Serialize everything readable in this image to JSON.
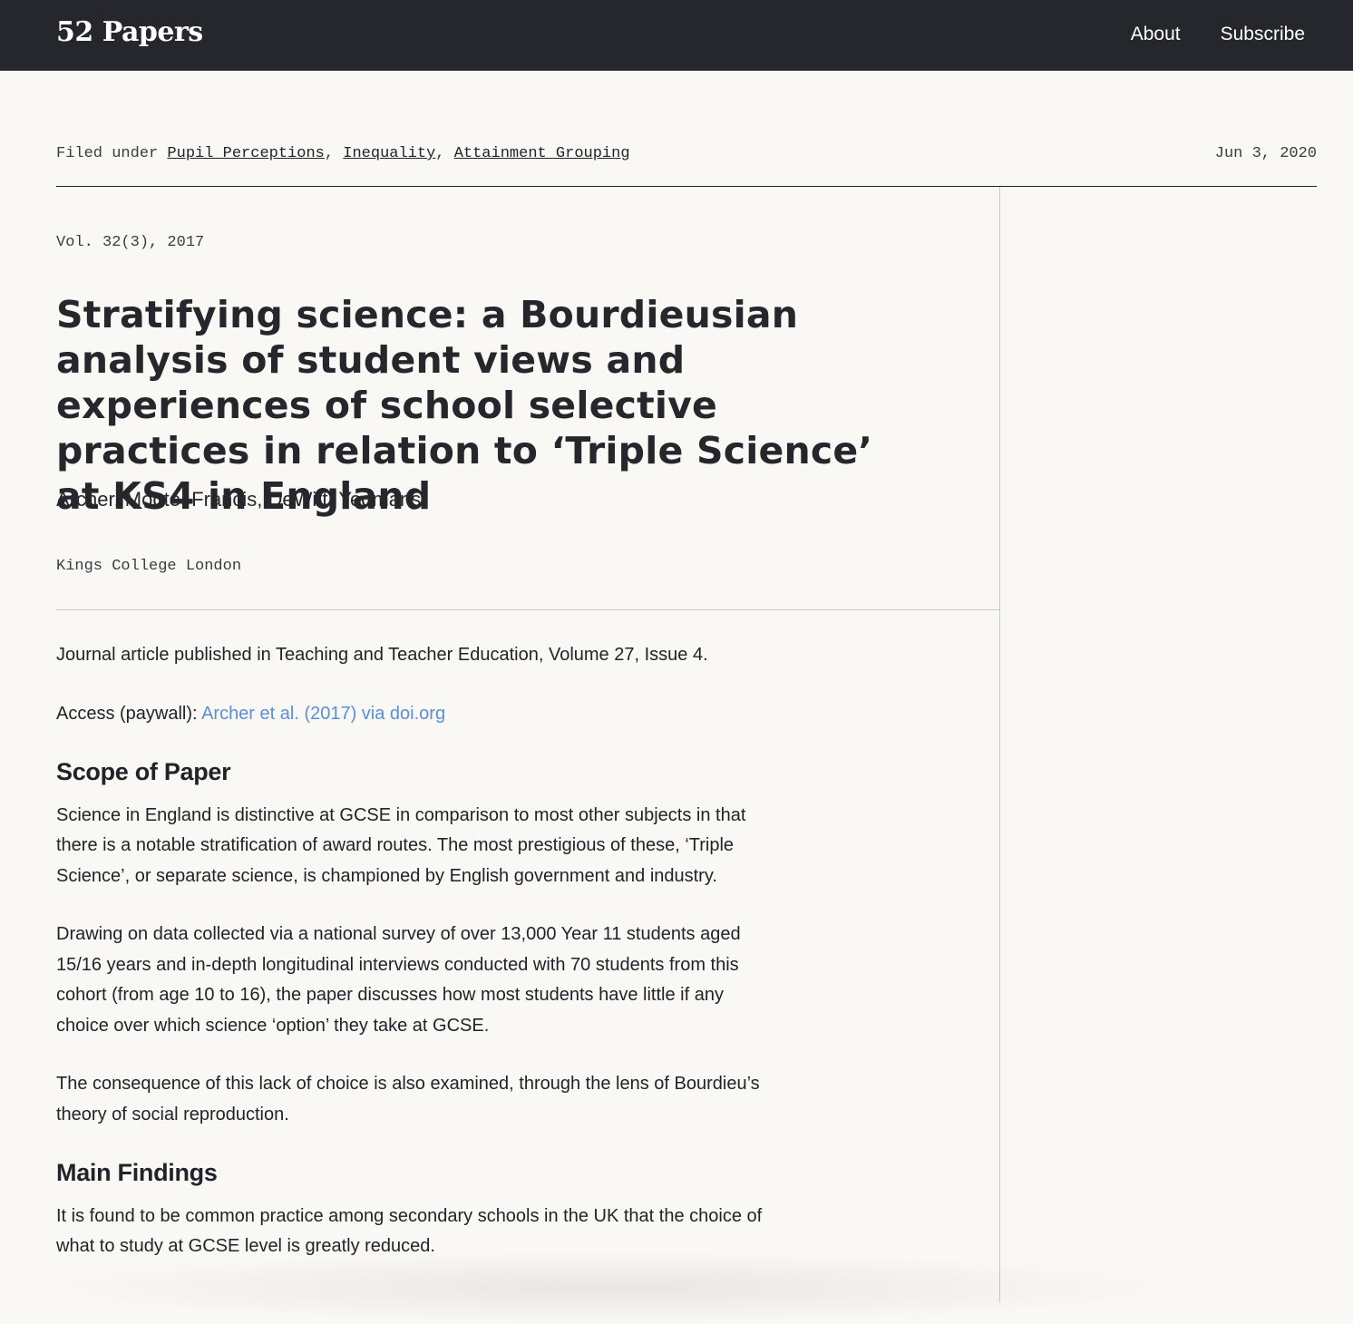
{
  "site": {
    "logo": "52 Papers",
    "nav": [
      "About",
      "Subscribe"
    ]
  },
  "meta": {
    "filed_prefix": "Filed under ",
    "tags": [
      "Pupil Perceptions",
      "Inequality",
      "Attainment Grouping"
    ],
    "separator": ", ",
    "date": "Jun 3, 2020"
  },
  "paper": {
    "volume": "Vol. 32(3), 2017",
    "title": "Stratifying science: a Bourdieusian analysis of student views and experiences of school selective practices in relation to ‘Triple Science’ at KS4 in England",
    "authors": "Archer, Moote, Francis, DeWitt, Yeomans",
    "institution": "Kings College London"
  },
  "content": {
    "published": "Journal article published in Teaching and Teacher Education, Volume 27, Issue 4.",
    "access_label": "Access (paywall): ",
    "access_link": "Archer et al. (2017) via doi.org",
    "scope_heading": "Scope of Paper",
    "scope_p1": "Science in England is distinctive at GCSE in comparison to most other subjects in that there is a notable stratification of award routes. The most prestigious of these, ‘Triple Science’, or separate science, is championed by English government and industry.",
    "scope_p2": "Drawing on data collected via a national survey of over 13,000 Year 11 students aged 15/16 years and in-depth longitudinal interviews conducted with 70 students from this cohort (from age 10 to 16), the paper discusses how most students have little if any choice over which science ‘option’ they take at GCSE.",
    "scope_p3": "The consequence of this lack of choice is also examined, through the lens of Bourdieu’s theory of social reproduction.",
    "findings_heading": "Main Findings",
    "findings_p1": "It is found to be common practice among secondary schools in the UK that the choice of what to study at GCSE level is greatly reduced."
  }
}
